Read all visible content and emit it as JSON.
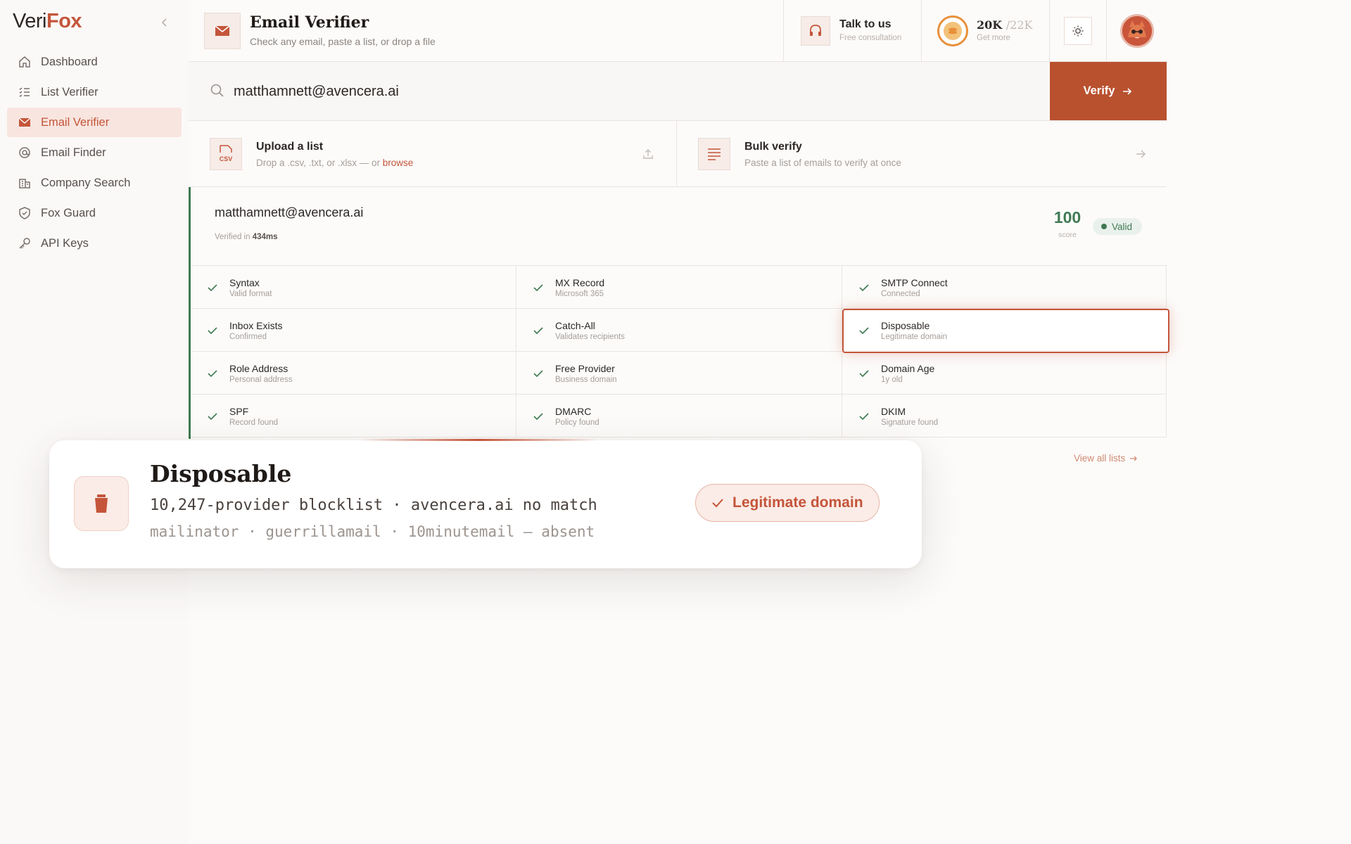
{
  "app": {
    "logo_a": "Veri",
    "logo_b": "Fox"
  },
  "sidebar": {
    "items": [
      {
        "label": "Dashboard",
        "icon": "home-icon"
      },
      {
        "label": "List Verifier",
        "icon": "list-icon"
      },
      {
        "label": "Email Verifier",
        "icon": "mail-icon",
        "active": true
      },
      {
        "label": "Email Finder",
        "icon": "at-search-icon"
      },
      {
        "label": "Company Search",
        "icon": "building-icon"
      },
      {
        "label": "Fox Guard",
        "icon": "shield-icon"
      },
      {
        "label": "API Keys",
        "icon": "key-icon"
      }
    ]
  },
  "header": {
    "title": "Email Verifier",
    "subtitle": "Check any email, paste a list, or drop a file",
    "talk_title": "Talk to us",
    "talk_sub": "Free consultation",
    "credits_used": "20K",
    "credits_max": "/22K",
    "credits_sub": "Get more"
  },
  "search": {
    "value": "matthamnett@avencera.ai",
    "verify_label": "Verify"
  },
  "upload": {
    "title": "Upload a list",
    "sub_prefix": "Drop a .csv, .txt, or .xlsx — or ",
    "sub_link": "browse",
    "icon_text": "CSV"
  },
  "bulk": {
    "title": "Bulk verify",
    "sub": "Paste a list of emails to verify at once"
  },
  "result": {
    "email": "matthamnett@avencera.ai",
    "time_prefix": "Verified in ",
    "time": "434ms",
    "score": "100",
    "score_label": "score",
    "status": "Valid",
    "checks": [
      {
        "title": "Syntax",
        "sub": "Valid format"
      },
      {
        "title": "MX Record",
        "sub": "Microsoft 365"
      },
      {
        "title": "SMTP Connect",
        "sub": "Connected"
      },
      {
        "title": "Inbox Exists",
        "sub": "Confirmed"
      },
      {
        "title": "Catch-All",
        "sub": "Validates recipients"
      },
      {
        "title": "Disposable",
        "sub": "Legitimate domain"
      },
      {
        "title": "Role Address",
        "sub": "Personal address"
      },
      {
        "title": "Free Provider",
        "sub": "Business domain"
      },
      {
        "title": "Domain Age",
        "sub": "1y old"
      },
      {
        "title": "SPF",
        "sub": "Record found"
      },
      {
        "title": "DMARC",
        "sub": "Policy found"
      },
      {
        "title": "DKIM",
        "sub": "Signature found"
      }
    ]
  },
  "view_all": "View all lists",
  "tooltip": {
    "title": "Disposable",
    "line1": "10,247-provider blocklist · avencera.ai no match",
    "line2": "mailinator · guerrillamail · 10minutemail — absent",
    "badge": "Legitimate domain"
  },
  "colors": {
    "accent": "#c4553a",
    "verify_bg": "#b9512f",
    "valid": "#3f7a52"
  }
}
